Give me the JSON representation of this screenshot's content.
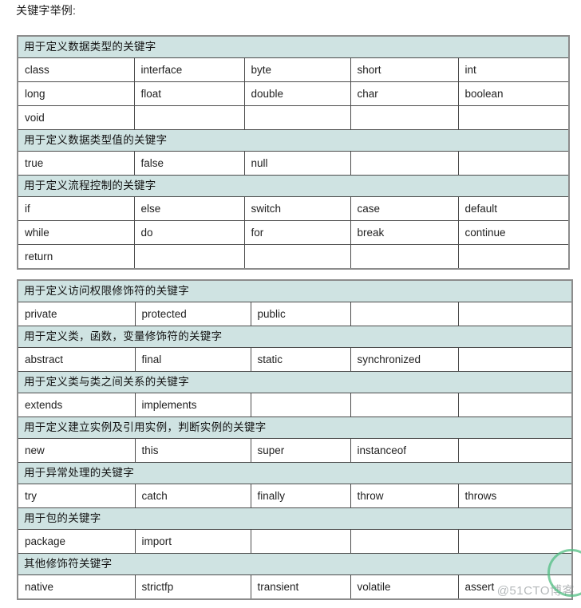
{
  "page": {
    "title": "关键字举例:"
  },
  "watermark": {
    "text": "@51CTO博客"
  },
  "tables": [
    {
      "id": "keyword-table-basic",
      "columns": 5,
      "sections": [
        {
          "heading": "用于定义数据类型的关键字",
          "rows": [
            [
              "class",
              "interface",
              "byte",
              "short",
              "int"
            ],
            [
              "long",
              "float",
              "double",
              "char",
              "boolean"
            ],
            [
              "void",
              "",
              "",
              "",
              ""
            ]
          ]
        },
        {
          "heading": "用于定义数据类型值的关键字",
          "rows": [
            [
              "true",
              "false",
              "null",
              "",
              ""
            ]
          ]
        },
        {
          "heading": "用于定义流程控制的关键字",
          "rows": [
            [
              "if",
              "else",
              "switch",
              "case",
              "default"
            ],
            [
              "while",
              "do",
              "for",
              "break",
              "continue"
            ],
            [
              "return",
              "",
              "",
              "",
              ""
            ]
          ]
        }
      ]
    },
    {
      "id": "keyword-table-modifiers",
      "columns": 5,
      "sections": [
        {
          "heading": "用于定义访问权限修饰符的关键字",
          "rows": [
            [
              "private",
              "protected",
              "public",
              "",
              ""
            ]
          ]
        },
        {
          "heading": "用于定义类，函数，变量修饰符的关键字",
          "rows": [
            [
              "abstract",
              "final",
              "static",
              "synchronized",
              ""
            ]
          ]
        },
        {
          "heading": "用于定义类与类之间关系的关键字",
          "rows": [
            [
              "extends",
              "implements",
              "",
              "",
              ""
            ]
          ]
        },
        {
          "heading": "用于定义建立实例及引用实例，判断实例的关键字",
          "rows": [
            [
              "new",
              "this",
              "super",
              "instanceof",
              ""
            ]
          ]
        },
        {
          "heading": "用于异常处理的关键字",
          "rows": [
            [
              "try",
              "catch",
              "finally",
              "throw",
              "throws"
            ]
          ]
        },
        {
          "heading": "用于包的关键字",
          "rows": [
            [
              "package",
              "import",
              "",
              "",
              ""
            ]
          ]
        },
        {
          "heading": "其他修饰符关键字",
          "rows": [
            [
              "native",
              "strictfp",
              "transient",
              "volatile",
              "assert"
            ]
          ]
        }
      ]
    }
  ]
}
